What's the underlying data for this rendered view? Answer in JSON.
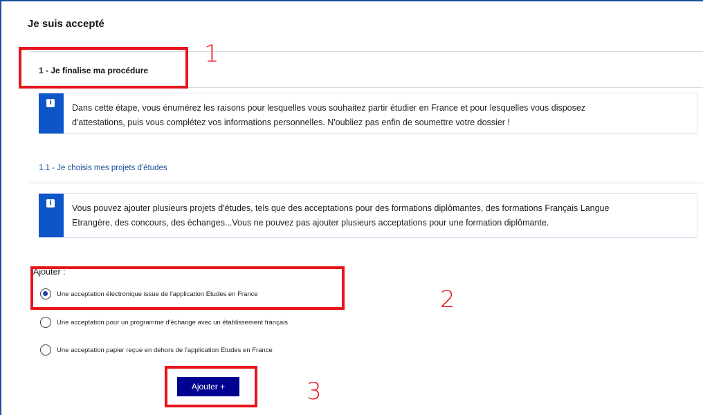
{
  "page": {
    "title": "Je suis accepté"
  },
  "section": {
    "title": "1 - Je finalise ma procédure"
  },
  "notice1": {
    "icon": "info-icon",
    "line1": "Dans cette étape, vous énumérez les raisons pour lesquelles vous souhaitez partir étudier en France et pour lesquelles vous disposez",
    "line2": "d'attestations, puis vous complétez vos informations personnelles. N'oubliez pas enfin de soumettre votre dossier !"
  },
  "subsection": {
    "title": "1.1 - Je choisis mes projets d'études"
  },
  "notice2": {
    "icon": "info-icon",
    "line1": "Vous pouvez ajouter plusieurs projets d'études, tels que des acceptations pour des formations diplômantes, des formations Français Langue",
    "line2": "Etrangère, des concours, des échanges...Vous ne pouvez pas ajouter plusieurs acceptations pour une formation diplômante."
  },
  "form": {
    "label": "Ajouter :",
    "options": [
      {
        "label": "Une acceptation électronique issue de l'application Etudes en France",
        "selected": true
      },
      {
        "label": "Une acceptation pour un programme d'échange avec un établissement français",
        "selected": false
      },
      {
        "label": "Une acceptation papier reçue en dehors de l'application Etudes en France",
        "selected": false
      }
    ],
    "button_label": "Ajouter +"
  },
  "annotations": {
    "n1": "1",
    "n2": "2",
    "n3": "3",
    "color": "#e8141b"
  }
}
